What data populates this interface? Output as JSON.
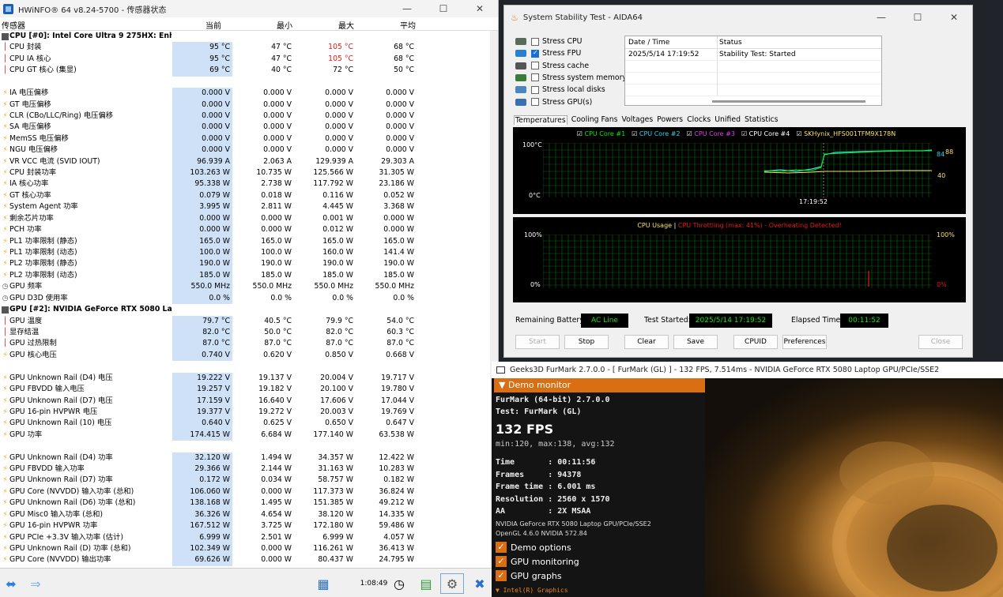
{
  "hwinfo": {
    "title": "HWiNFO® 64 v8.24-5700 - 传感器状态",
    "columns": [
      "传感器",
      "当前",
      "最小",
      "最大",
      "平均"
    ],
    "rows": [
      {
        "g": true,
        "ic": "cpu",
        "n": "CPU [#0]: Intel Core Ultra 9 275HX: Enhanced"
      },
      {
        "ic": "t",
        "n": "CPU 封装",
        "c": "95 °C",
        "mn": "47 °C",
        "mx": "105 °C",
        "av": "68 °C",
        "red": true
      },
      {
        "ic": "t",
        "n": "CPU IA 核心",
        "c": "95 °C",
        "mn": "47 °C",
        "mx": "105 °C",
        "av": "68 °C",
        "red": true
      },
      {
        "ic": "t",
        "n": "CPU GT 核心 (集显)",
        "c": "69 °C",
        "mn": "40 °C",
        "mx": "72 °C",
        "av": "50 °C"
      },
      {
        "e": true
      },
      {
        "ic": "b",
        "n": "IA 电压偏移",
        "c": "0.000 V",
        "mn": "0.000 V",
        "mx": "0.000 V",
        "av": "0.000 V"
      },
      {
        "ic": "b",
        "n": "GT 电压偏移",
        "c": "0.000 V",
        "mn": "0.000 V",
        "mx": "0.000 V",
        "av": "0.000 V"
      },
      {
        "ic": "b",
        "n": "CLR (CBo/LLC/Ring) 电压偏移",
        "c": "0.000 V",
        "mn": "0.000 V",
        "mx": "0.000 V",
        "av": "0.000 V"
      },
      {
        "ic": "b",
        "n": "SA 电压偏移",
        "c": "0.000 V",
        "mn": "0.000 V",
        "mx": "0.000 V",
        "av": "0.000 V"
      },
      {
        "ic": "b",
        "n": "MemSS 电压偏移",
        "c": "0.000 V",
        "mn": "0.000 V",
        "mx": "0.000 V",
        "av": "0.000 V"
      },
      {
        "ic": "b",
        "n": "NGU 电压偏移",
        "c": "0.000 V",
        "mn": "0.000 V",
        "mx": "0.000 V",
        "av": "0.000 V"
      },
      {
        "ic": "b",
        "n": "VR VCC 电流 (SVID IOUT)",
        "c": "96.939 A",
        "mn": "2.063 A",
        "mx": "129.939 A",
        "av": "29.303 A"
      },
      {
        "ic": "b",
        "n": "CPU 封装功率",
        "c": "103.263 W",
        "mn": "10.735 W",
        "mx": "125.566 W",
        "av": "31.305 W"
      },
      {
        "ic": "b",
        "n": "IA 核心功率",
        "c": "95.338 W",
        "mn": "2.738 W",
        "mx": "117.792 W",
        "av": "23.186 W"
      },
      {
        "ic": "b",
        "n": "GT 核心功率",
        "c": "0.079 W",
        "mn": "0.018 W",
        "mx": "0.116 W",
        "av": "0.052 W"
      },
      {
        "ic": "b",
        "n": "System Agent 功率",
        "c": "3.995 W",
        "mn": "2.811 W",
        "mx": "4.445 W",
        "av": "3.368 W"
      },
      {
        "ic": "b",
        "n": "剩余芯片功率",
        "c": "0.000 W",
        "mn": "0.000 W",
        "mx": "0.001 W",
        "av": "0.000 W"
      },
      {
        "ic": "b",
        "n": "PCH 功率",
        "c": "0.000 W",
        "mn": "0.000 W",
        "mx": "0.012 W",
        "av": "0.000 W"
      },
      {
        "ic": "b",
        "n": "PL1 功率限制 (静态)",
        "c": "165.0 W",
        "mn": "165.0 W",
        "mx": "165.0 W",
        "av": "165.0 W"
      },
      {
        "ic": "b",
        "n": "PL1 功率限制 (动态)",
        "c": "100.0 W",
        "mn": "100.0 W",
        "mx": "160.0 W",
        "av": "141.4 W"
      },
      {
        "ic": "b",
        "n": "PL2 功率限制 (静态)",
        "c": "190.0 W",
        "mn": "190.0 W",
        "mx": "190.0 W",
        "av": "190.0 W"
      },
      {
        "ic": "b",
        "n": "PL2 功率限制 (动态)",
        "c": "185.0 W",
        "mn": "185.0 W",
        "mx": "185.0 W",
        "av": "185.0 W"
      },
      {
        "ic": "g",
        "n": "GPU 频率",
        "c": "550.0 MHz",
        "mn": "550.0 MHz",
        "mx": "550.0 MHz",
        "av": "550.0 MHz"
      },
      {
        "ic": "g",
        "n": "GPU D3D 使用率",
        "c": "0.0 %",
        "mn": "0.0 %",
        "mx": "0.0 %",
        "av": "0.0 %"
      },
      {
        "g": true,
        "ic": "cpu",
        "n": "GPU [#2]: NVIDIA GeForce RTX 5080 Laptop"
      },
      {
        "ic": "t",
        "n": "GPU 温度",
        "c": "79.7 °C",
        "mn": "40.5 °C",
        "mx": "79.9 °C",
        "av": "54.0 °C"
      },
      {
        "ic": "t",
        "n": "显存结温",
        "c": "82.0 °C",
        "mn": "50.0 °C",
        "mx": "82.0 °C",
        "av": "60.3 °C"
      },
      {
        "ic": "t",
        "n": "GPU 过热限制",
        "c": "87.0 °C",
        "mn": "87.0 °C",
        "mx": "87.0 °C",
        "av": "87.0 °C"
      },
      {
        "ic": "b",
        "n": "GPU 核心电压",
        "c": "0.740 V",
        "mn": "0.620 V",
        "mx": "0.850 V",
        "av": "0.668 V"
      },
      {
        "e": true
      },
      {
        "ic": "b",
        "n": "GPU Unknown Rail (D4) 电压",
        "c": "19.222 V",
        "mn": "19.137 V",
        "mx": "20.004 V",
        "av": "19.717 V"
      },
      {
        "ic": "b",
        "n": "GPU FBVDD 输入电压",
        "c": "19.257 V",
        "mn": "19.182 V",
        "mx": "20.100 V",
        "av": "19.780 V"
      },
      {
        "ic": "b",
        "n": "GPU Unknown Rail (D7) 电压",
        "c": "17.159 V",
        "mn": "16.640 V",
        "mx": "17.606 V",
        "av": "17.044 V"
      },
      {
        "ic": "b",
        "n": "GPU 16-pin HVPWR 电压",
        "c": "19.377 V",
        "mn": "19.272 V",
        "mx": "20.003 V",
        "av": "19.769 V"
      },
      {
        "ic": "b",
        "n": "GPU Unknown Rail (10) 电压",
        "c": "0.640 V",
        "mn": "0.625 V",
        "mx": "0.650 V",
        "av": "0.647 V"
      },
      {
        "ic": "b",
        "n": "GPU 功率",
        "c": "174.415 W",
        "mn": "6.684 W",
        "mx": "177.140 W",
        "av": "63.538 W"
      },
      {
        "e": true
      },
      {
        "ic": "b",
        "n": "GPU Unknown Rail (D4) 功率",
        "c": "32.120 W",
        "mn": "1.494 W",
        "mx": "34.357 W",
        "av": "12.422 W"
      },
      {
        "ic": "b",
        "n": "GPU FBVDD 输入功率",
        "c": "29.366 W",
        "mn": "2.144 W",
        "mx": "31.163 W",
        "av": "10.283 W"
      },
      {
        "ic": "b",
        "n": "GPU Unknown Rail (D7) 功率",
        "c": "0.172 W",
        "mn": "0.034 W",
        "mx": "58.757 W",
        "av": "0.182 W"
      },
      {
        "ic": "b",
        "n": "GPU Core (NVVDD) 输入功率 (总和)",
        "c": "106.060 W",
        "mn": "0.000 W",
        "mx": "117.373 W",
        "av": "36.824 W"
      },
      {
        "ic": "b",
        "n": "GPU Unknown Rail (D6) 功率 (总和)",
        "c": "138.168 W",
        "mn": "1.495 W",
        "mx": "151.385 W",
        "av": "49.212 W"
      },
      {
        "ic": "b",
        "n": "GPU Misc0 输入功率 (总和)",
        "c": "36.326 W",
        "mn": "4.654 W",
        "mx": "38.120 W",
        "av": "14.335 W"
      },
      {
        "ic": "b",
        "n": "GPU 16-pin HVPWR 功率",
        "c": "167.512 W",
        "mn": "3.725 W",
        "mx": "172.180 W",
        "av": "59.486 W"
      },
      {
        "ic": "b",
        "n": "GPU PCIe +3.3V 输入功率 (估计)",
        "c": "6.999 W",
        "mn": "2.501 W",
        "mx": "6.999 W",
        "av": "4.057 W"
      },
      {
        "ic": "b",
        "n": "GPU Unknown Rail (D) 功率 (总和)",
        "c": "102.349 W",
        "mn": "0.000 W",
        "mx": "116.261 W",
        "av": "36.413 W"
      },
      {
        "ic": "b",
        "n": "GPU Core (NVVDD) 输出功率",
        "c": "69.626 W",
        "mn": "0.000 W",
        "mx": "80.437 W",
        "av": "24.795 W"
      }
    ],
    "footer_time": "1:08:49"
  },
  "aida": {
    "title": "System Stability Test - AIDA64",
    "stress": [
      {
        "label": "Stress CPU",
        "on": false
      },
      {
        "label": "Stress FPU",
        "on": true
      },
      {
        "label": "Stress cache",
        "on": false
      },
      {
        "label": "Stress system memory",
        "on": false
      },
      {
        "label": "Stress local disks",
        "on": false
      },
      {
        "label": "Stress GPU(s)",
        "on": false
      }
    ],
    "table_head": [
      "Date / Time",
      "Status"
    ],
    "table_row": [
      "2025/5/14 17:19:52",
      "Stability Test: Started"
    ],
    "tabs": [
      "Temperatures",
      "Cooling Fans",
      "Voltages",
      "Powers",
      "Clocks",
      "Unified",
      "Statistics"
    ],
    "legend": [
      {
        "label": "CPU Core #1",
        "color": "#16e316"
      },
      {
        "label": "CPU Core #2",
        "color": "#2fd3e8"
      },
      {
        "label": "CPU Core #3",
        "color": "#e042e8"
      },
      {
        "label": "CPU Core #4",
        "color": "#ffffff"
      },
      {
        "label": "SKHynix_HFS001TFM9X178N",
        "color": "#f5e36a"
      }
    ],
    "temp_top": "100°C",
    "temp_bottom": "0°C",
    "temp_time": "17:19:52",
    "temp_r1": "84",
    "temp_r1b": "88",
    "temp_r2": "40",
    "usage_title": "CPU Usage",
    "usage_sep": "|",
    "throttle": "CPU Throttling (max: 41%) - Overheating Detected!",
    "u_top": "100%",
    "u_bottom": "0%",
    "u_rtop": "100%",
    "u_rbottom": "0%",
    "battery_label": "Remaining Battery:",
    "battery_val": "AC Line",
    "started_label": "Test Started:",
    "started_val": "2025/5/14 17:19:52",
    "elapsed_label": "Elapsed Time:",
    "elapsed_val": "00:11:52",
    "buttons": [
      "Start",
      "Stop",
      "Clear",
      "Save",
      "CPUID",
      "Preferences",
      "Close"
    ]
  },
  "furmark": {
    "title": "Geeks3D FurMark 2.7.0.0 - [ FurMark (GL) ] - 132 FPS, 7.514ms - NVIDIA GeForce RTX 5080 Laptop GPU/PCIe/SSE2",
    "panel": "Demo monitor",
    "line1": "FurMark (64-bit) 2.7.0.0",
    "line2": "Test: FurMark (GL)",
    "fps": "132 FPS",
    "minmax": "min:120, max:138, avg:132",
    "time": "Time       : 00:11:56",
    "frames": "Frames     : 94378",
    "frametime": "Frame time : 6.001 ms",
    "res": "Resolution : 2560 x 1570",
    "aa": "AA         : 2X MSAA",
    "gpu1": "NVIDIA GeForce RTX 5080 Laptop GPU/PCIe/SSE2",
    "gpu2": "OpenGL 4.6.0 NVIDIA 572.84",
    "opts": [
      "Demo options",
      "GPU monitoring",
      "GPU graphs"
    ],
    "intel": "Intel(R) Graphics"
  }
}
